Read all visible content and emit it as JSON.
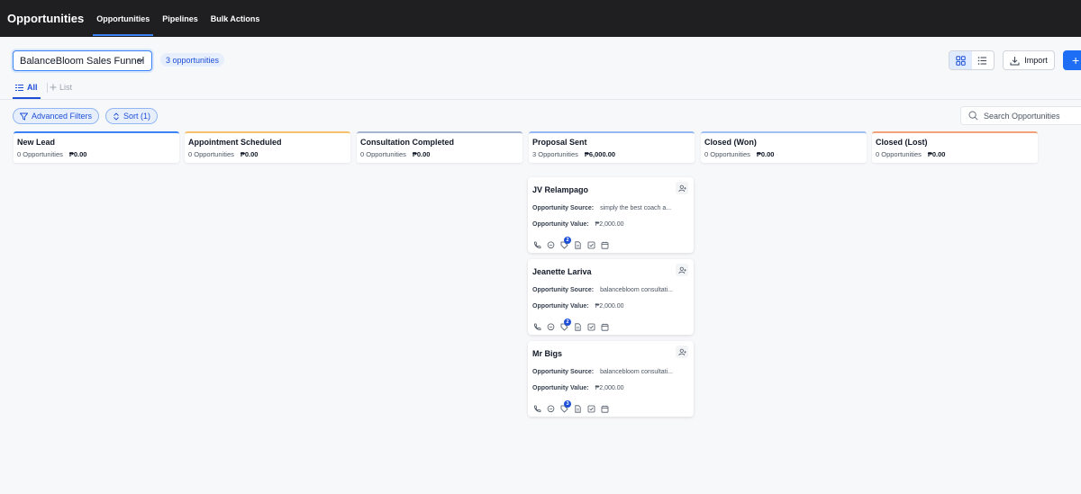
{
  "topbar": {
    "app_title": "Opportunities",
    "nav": [
      {
        "label": "Opportunities"
      },
      {
        "label": "Pipelines"
      },
      {
        "label": "Bulk Actions"
      }
    ]
  },
  "toolbar": {
    "pipeline": "BalanceBloom Sales Funnel",
    "count_badge": "3 opportunities",
    "import_label": "Import",
    "add_label": "+"
  },
  "tabs": {
    "all": "All",
    "add_list": "List"
  },
  "filters": {
    "advanced": "Advanced Filters",
    "sort": "Sort (1)",
    "search_placeholder": "Search Opportunities"
  },
  "stages": [
    {
      "name": "New Lead",
      "count": "0 Opportunities",
      "value": "₱0.00",
      "color": "#3b82f6"
    },
    {
      "name": "Appointment Scheduled",
      "count": "0 Opportunities",
      "value": "₱0.00",
      "color": "#f5c26b"
    },
    {
      "name": "Consultation Completed",
      "count": "0 Opportunities",
      "value": "₱0.00",
      "color": "#a5b4cf"
    },
    {
      "name": "Proposal Sent",
      "count": "3 Opportunities",
      "value": "₱6,000.00",
      "color": "#93b7f3"
    },
    {
      "name": "Closed (Won)",
      "count": "0 Opportunities",
      "value": "₱0.00",
      "color": "#9fc0f5"
    },
    {
      "name": "Closed (Lost)",
      "count": "0 Opportunities",
      "value": "₱0.00",
      "color": "#f4a27a"
    }
  ],
  "card_labels": {
    "source": "Opportunity Source:",
    "value": "Opportunity Value:"
  },
  "cards": [
    {
      "name": "JV Relampago",
      "source": "simply the best coach a...",
      "value": "₱2,000.00",
      "badge": "2"
    },
    {
      "name": "Jeanette Lariva",
      "source": "balancebloom consultati...",
      "value": "₱2,000.00",
      "badge": "2"
    },
    {
      "name": "Mr Bigs",
      "source": "balancebloom consultati...",
      "value": "₱2,000.00",
      "badge": "3"
    }
  ],
  "colors": {
    "accent": "#1d6ef5",
    "topbar": "#1f1f22"
  }
}
